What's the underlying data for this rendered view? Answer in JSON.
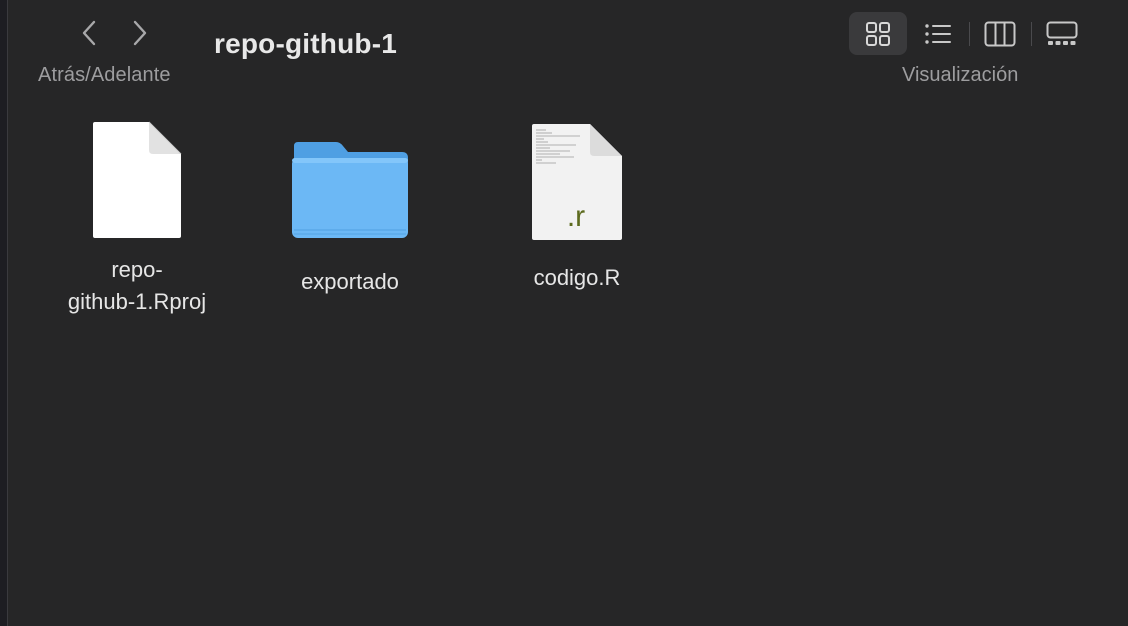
{
  "window": {
    "title": "repo-github-1"
  },
  "toolbar": {
    "nav_caption": "Atrás/Adelante",
    "back_icon": "chevron-left-icon",
    "forward_icon": "chevron-right-icon",
    "view_caption": "Visualización",
    "view_modes": [
      {
        "icon": "icon-view-grid-icon",
        "active": true
      },
      {
        "icon": "list-view-icon",
        "active": false
      },
      {
        "icon": "column-view-icon",
        "active": false
      },
      {
        "icon": "gallery-view-icon",
        "active": false
      }
    ]
  },
  "files": [
    {
      "name_line1": "repo-",
      "name_line2": "github-1.Rproj",
      "kind": "document"
    },
    {
      "name": "exportado",
      "kind": "folder",
      "color": "#6cb8f5"
    },
    {
      "name": "codigo.R",
      "kind": "r-script",
      "badge": ".r",
      "badge_color": "#5d6b1f"
    }
  ],
  "colors": {
    "background": "#262627",
    "text": "#e6e6e6",
    "caption": "#9d9d9f",
    "active_view_bg": "#3a3a3c"
  }
}
